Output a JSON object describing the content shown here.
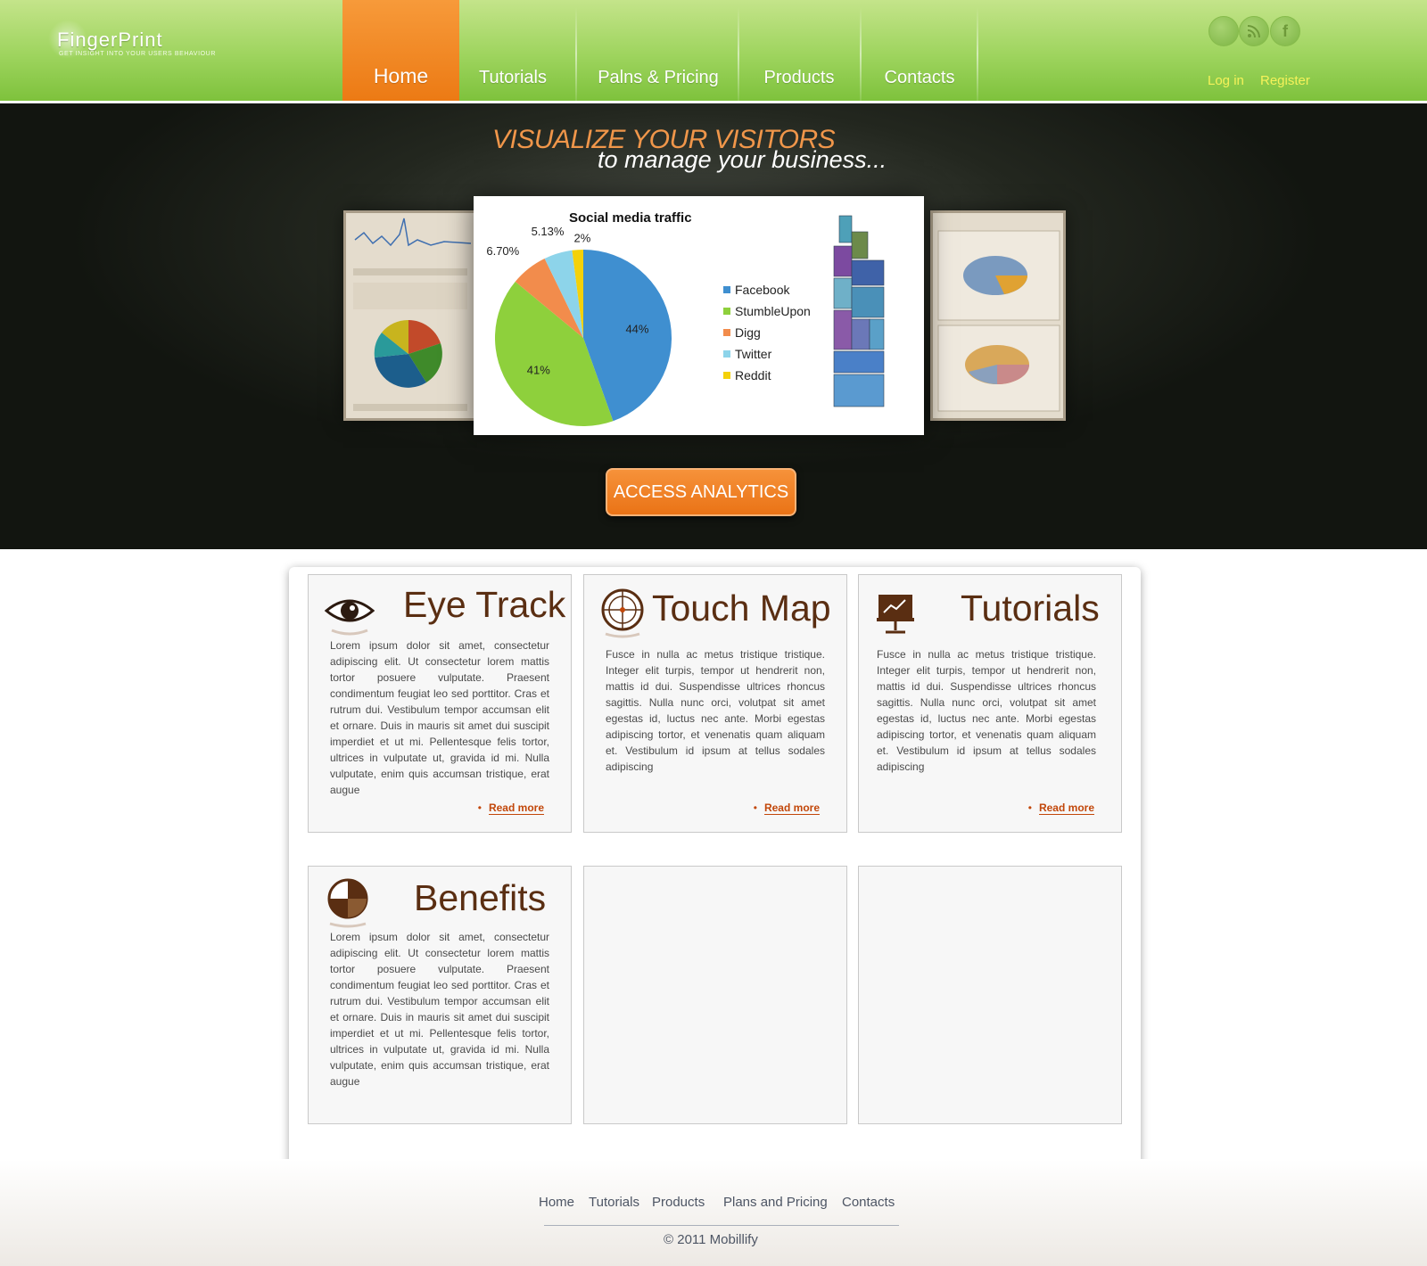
{
  "brand": {
    "name": "FingerPrint",
    "tagline": "GET INSIGHT INTO YOUR USERS BEHAVIOUR"
  },
  "nav": {
    "items": [
      {
        "label": "Home",
        "active": true
      },
      {
        "label": "Tutorials"
      },
      {
        "label": "Palns & Pricing"
      },
      {
        "label": "Products"
      },
      {
        "label": "Contacts"
      }
    ],
    "login": "Log in",
    "register": "Register",
    "social_icons": [
      "circle-icon",
      "rss-icon",
      "facebook-icon"
    ]
  },
  "hero": {
    "title": "VISUALIZE YOUR VISITORS",
    "subtitle": "to manage your business...",
    "cta": "ACCESS ANALYTICS"
  },
  "chart_data": {
    "type": "pie",
    "title": "Social media traffic",
    "slices": [
      {
        "label": "Facebook",
        "value": 44,
        "display": "44%",
        "color": "#3f8fd0"
      },
      {
        "label": "StumbleUpon",
        "value": 41,
        "display": "41%",
        "color": "#8ed03c"
      },
      {
        "label": "Digg",
        "value": 6.7,
        "display": "6.70%",
        "color": "#f28c4c"
      },
      {
        "label": "Twitter",
        "value": 5.13,
        "display": "5.13%",
        "color": "#8dd4ea"
      },
      {
        "label": "Reddit",
        "value": 2,
        "display": "2%",
        "color": "#f4d10a"
      }
    ],
    "legend_position": "right"
  },
  "features": [
    {
      "title": "Eye Track",
      "icon": "eye-icon",
      "text": "Lorem ipsum dolor sit amet, consectetur adipiscing elit. Ut consectetur lorem mattis tortor posuere vulputate. Praesent condimentum feugiat leo sed porttitor. Cras et rutrum dui. Vestibulum tempor accumsan elit et ornare. Duis in mauris sit amet dui suscipit imperdiet et ut mi. Pellentesque felis tortor, ultrices in vulputate ut, gravida id mi. Nulla vulputate, enim quis accumsan tristique, erat augue",
      "read_more": "Read more"
    },
    {
      "title": "Touch Map",
      "icon": "crosshair-icon",
      "text": "Fusce in nulla ac metus tristique tristique. Integer elit turpis, tempor ut hendrerit non, mattis id dui. Suspendisse ultrices rhoncus sagittis. Nulla nunc orci, volutpat sit amet egestas id, luctus nec ante. Morbi egestas adipiscing tortor, et venenatis quam aliquam et. Vestibulum id ipsum at tellus sodales adipiscing",
      "read_more": "Read more"
    },
    {
      "title": "Tutorials",
      "icon": "presentation-icon",
      "text": "Fusce in nulla ac metus tristique tristique. Integer elit turpis, tempor ut hendrerit non, mattis id dui. Suspendisse ultrices rhoncus sagittis. Nulla nunc orci, volutpat sit amet egestas id, luctus nec ante. Morbi egestas adipiscing tortor, et venenatis quam aliquam et. Vestibulum id ipsum at tellus sodales adipiscing",
      "read_more": "Read more"
    },
    {
      "title": "Benefits",
      "icon": "pie-chart-icon",
      "text": "Lorem ipsum dolor sit amet, consectetur adipiscing elit. Ut consectetur lorem mattis tortor posuere vulputate. Praesent condimentum feugiat leo sed porttitor. Cras et rutrum dui. Vestibulum tempor accumsan elit et ornare. Duis in mauris sit amet dui suscipit imperdiet et ut mi. Pellentesque felis tortor, ultrices in vulputate ut, gravida id mi. Nulla vulputate, enim quis accumsan tristique, erat augue"
    }
  ],
  "footer": {
    "links": [
      "Home",
      "Tutorials",
      "Products",
      "Plans and Pricing",
      "Contacts"
    ],
    "copyright": "2011 Mobillify"
  },
  "colors": {
    "accent": "#ec7a14",
    "header_green": "#9ed45e",
    "heading_brown": "#5a2e12",
    "link_orange": "#c2470a"
  }
}
